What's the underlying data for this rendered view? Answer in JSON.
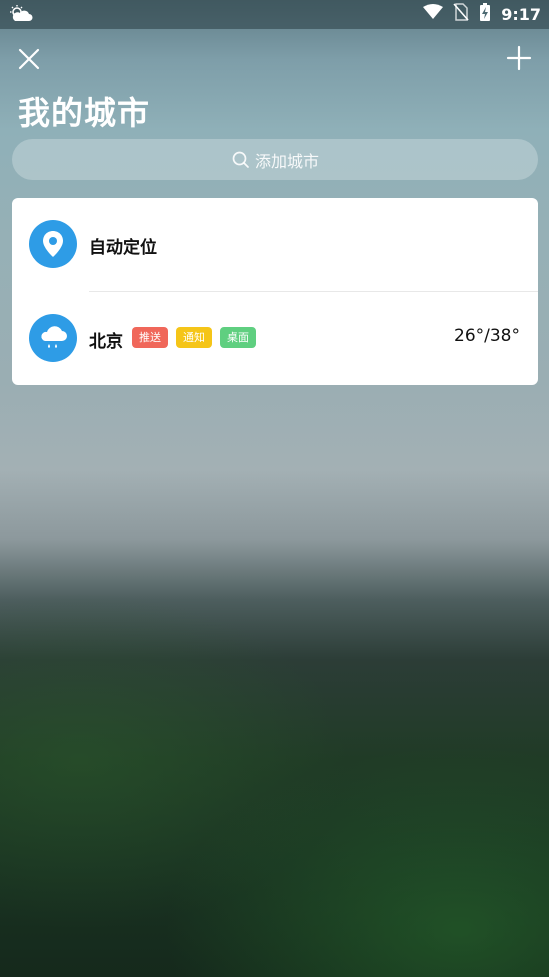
{
  "status_bar": {
    "time": "9:17",
    "icons": [
      "weather-notification-icon",
      "wifi-icon",
      "no-sim-icon",
      "battery-charging-icon"
    ]
  },
  "header": {
    "title": "我的城市",
    "close_icon": "close-icon",
    "add_icon": "plus-icon"
  },
  "search": {
    "placeholder": "添加城市",
    "icon": "search-icon"
  },
  "cities": [
    {
      "name": "自动定位",
      "icon": "location-pin-icon",
      "tags": [],
      "temperature": ""
    },
    {
      "name": "北京",
      "icon": "rain-cloud-icon",
      "tags": [
        {
          "label": "推送",
          "color": "#f0675a"
        },
        {
          "label": "通知",
          "color": "#f5c518"
        },
        {
          "label": "桌面",
          "color": "#5fcf80"
        }
      ],
      "temperature": "26°/38°"
    }
  ],
  "colors": {
    "accent": "#2e9ce6",
    "card": "#ffffff"
  }
}
